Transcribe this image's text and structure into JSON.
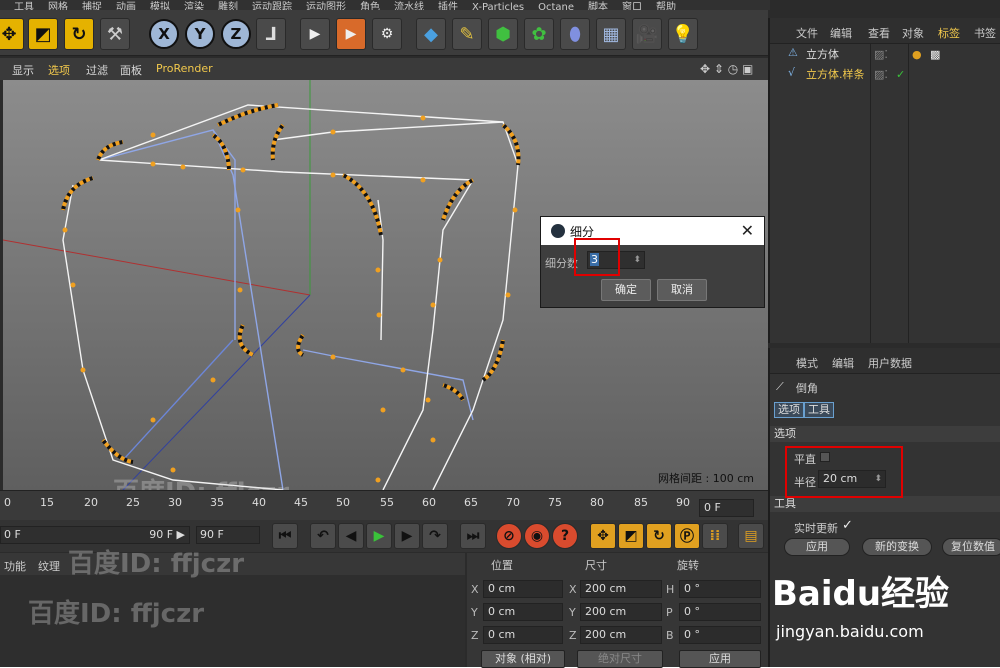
{
  "menubar": [
    "工具",
    "网格",
    "捕捉",
    "动画",
    "模拟",
    "渲染",
    "雕刻",
    "运动跟踪",
    "运动图形",
    "角色",
    "流水线",
    "插件",
    "X-Particles",
    "Octane",
    "脚本",
    "窗口",
    "帮助"
  ],
  "viewport_menu": {
    "items": [
      "显示",
      "选项",
      "过滤",
      "面板",
      "ProRender"
    ],
    "grid_spacing": "网格间距 : 100 cm"
  },
  "dialog": {
    "title": "细分",
    "field_label": "细分数",
    "field_value": "3",
    "ok_label": "确定",
    "cancel_label": "取消",
    "close": "✕"
  },
  "timeline": {
    "ticks": [
      "0",
      "15",
      "20",
      "25",
      "30",
      "35",
      "40",
      "45",
      "50",
      "55",
      "60",
      "65",
      "70",
      "75",
      "80",
      "85",
      "90"
    ],
    "current_frame": "0 F"
  },
  "transport": {
    "start_frame": "0 F",
    "end_frame_a": "90 F ▶",
    "end_frame_b": "90 F"
  },
  "material_panel": {
    "tabs": [
      "功能",
      "纹理"
    ]
  },
  "coordinates": {
    "headers": [
      "位置",
      "尺寸",
      "旋转"
    ],
    "rows": [
      {
        "axis": "X",
        "pos": "0 cm",
        "size_axis": "X",
        "size": "200 cm",
        "rot_axis": "H",
        "rot": "0 °"
      },
      {
        "axis": "Y",
        "pos": "0 cm",
        "size_axis": "Y",
        "size": "200 cm",
        "rot_axis": "P",
        "rot": "0 °"
      },
      {
        "axis": "Z",
        "pos": "0 cm",
        "size_axis": "Z",
        "size": "200 cm",
        "rot_axis": "B",
        "rot": "0 °"
      }
    ],
    "mode_select": "对象 (相对)",
    "size_mode": "绝对尺寸",
    "apply_label": "应用"
  },
  "object_manager": {
    "tabs": [
      "文件",
      "编辑",
      "查看",
      "对象",
      "标签",
      "书签"
    ],
    "active_tab": "标签",
    "objects": [
      "立方体",
      "立方体.样条"
    ]
  },
  "attribute_manager": {
    "tabs": [
      "模式",
      "编辑",
      "用户数据"
    ],
    "tool_name": "倒角",
    "subtabs": [
      "选项",
      "工具"
    ],
    "section_options": "选项",
    "flat_label": "平直",
    "radius_label": "半径",
    "radius_value": "20 cm",
    "section_tool": "工具",
    "realtime_label": "实时更新",
    "realtime_check": "✓",
    "buttons": [
      "应用",
      "新的变换",
      "复位数值"
    ]
  },
  "watermarks": {
    "baidu_logo": "Baidu经验",
    "baidu_url": "jingyan.baidu.com",
    "user_id": "百度ID: ffjczr"
  },
  "colors": {
    "accent": "#f2c94c",
    "highlight_box": "#e00000",
    "spline": "#f0a020",
    "edge": "#ffffff",
    "edge_back": "#6c86d8"
  }
}
